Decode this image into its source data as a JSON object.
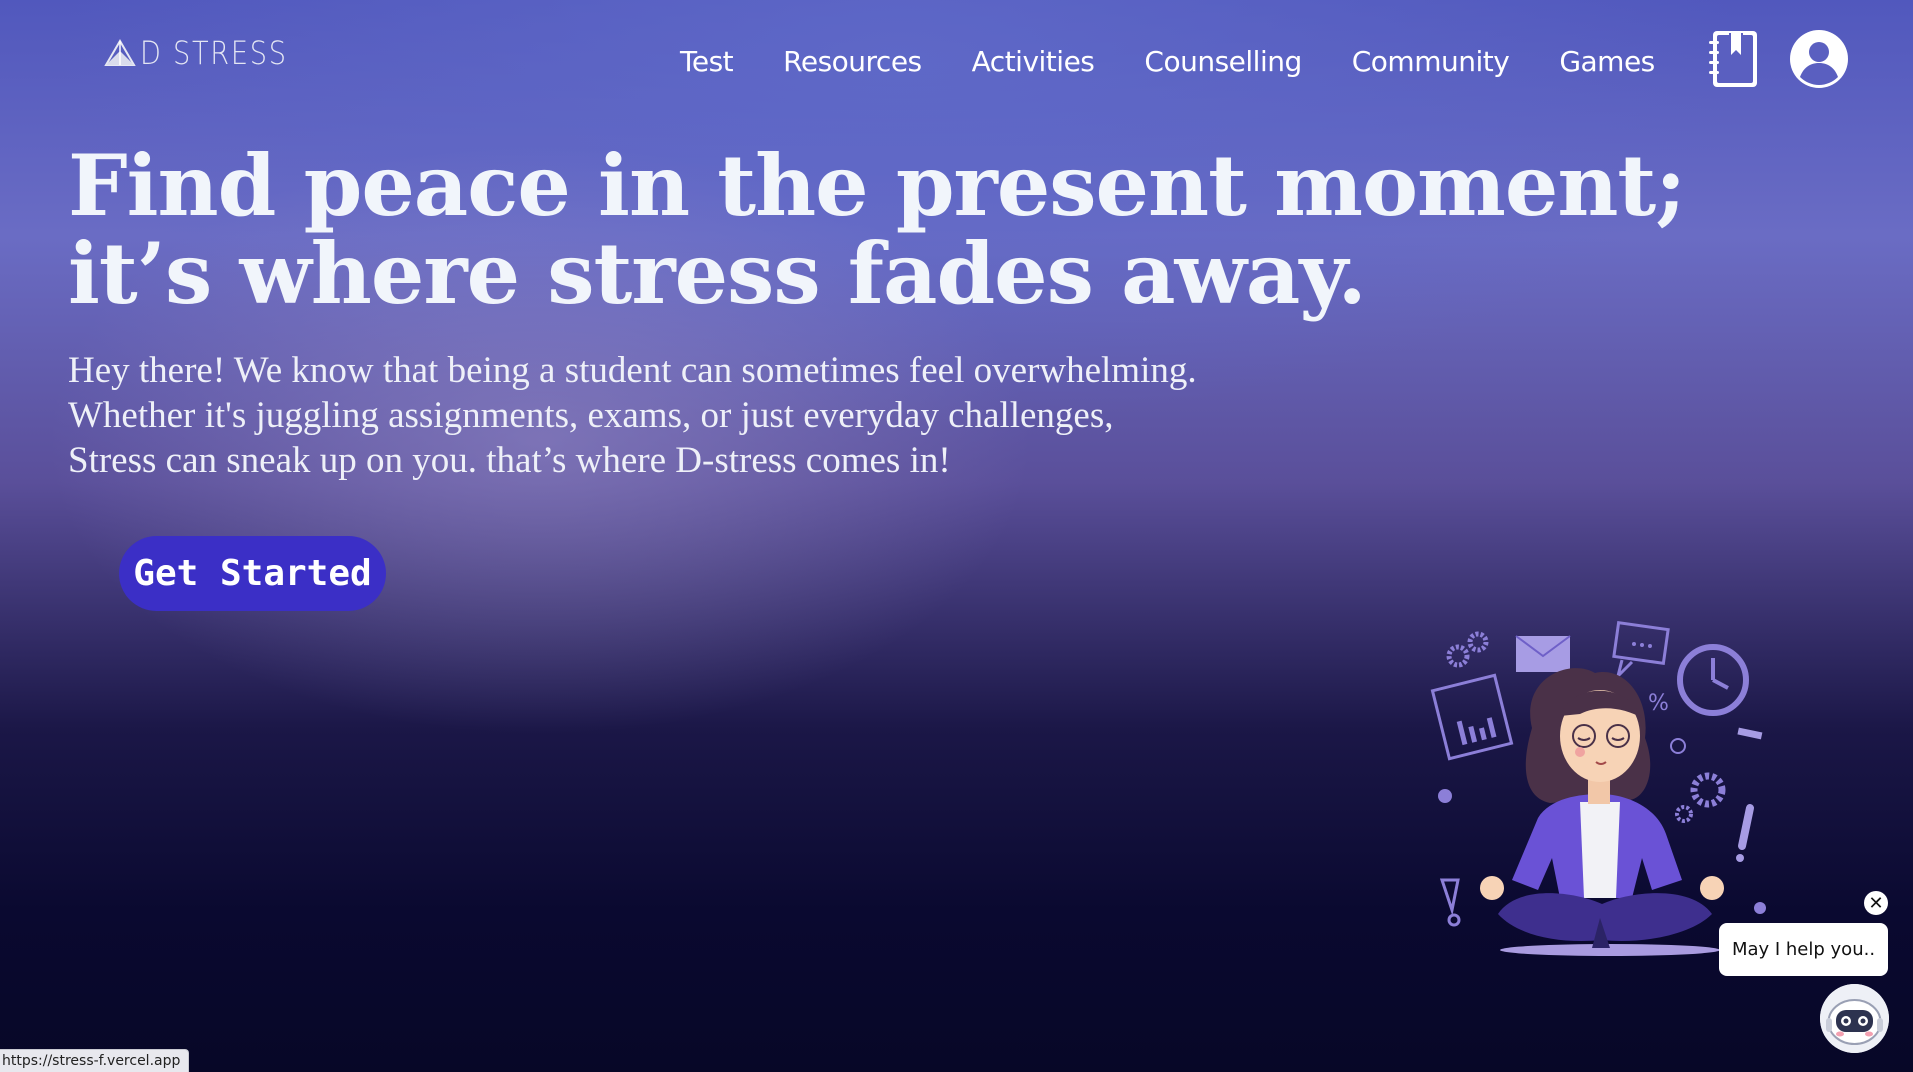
{
  "brand": {
    "name": "D STRESS",
    "logo_icon": "paper-plane-logo-icon"
  },
  "nav": {
    "items": [
      {
        "label": "Test"
      },
      {
        "label": "Resources"
      },
      {
        "label": "Activities"
      },
      {
        "label": "Counselling"
      },
      {
        "label": "Community"
      },
      {
        "label": "Games"
      }
    ],
    "journal_icon": "journal-bookmark-icon",
    "profile_icon": "user-circle-icon"
  },
  "hero": {
    "title": "Find peace in the present moment; it’s where stress fades away.",
    "subtitle_lines": [
      "Hey there! We know that being a student can sometimes feel overwhelming.",
      "Whether it's juggling assignments, exams, or just everyday challenges,",
      "Stress can sneak up on you. that’s where D-stress comes in!"
    ],
    "cta_label": "Get Started",
    "illustration": "meditating-woman-illustration"
  },
  "chat": {
    "bubble_text": "May I help you..",
    "close_label": "✕",
    "bot_icon": "robot-avatar-icon"
  },
  "status_bar": {
    "url": "https://stress-f.vercel.app"
  },
  "colors": {
    "cta_background": "#3b2fc6",
    "accent_purple": "#6b55c9"
  }
}
